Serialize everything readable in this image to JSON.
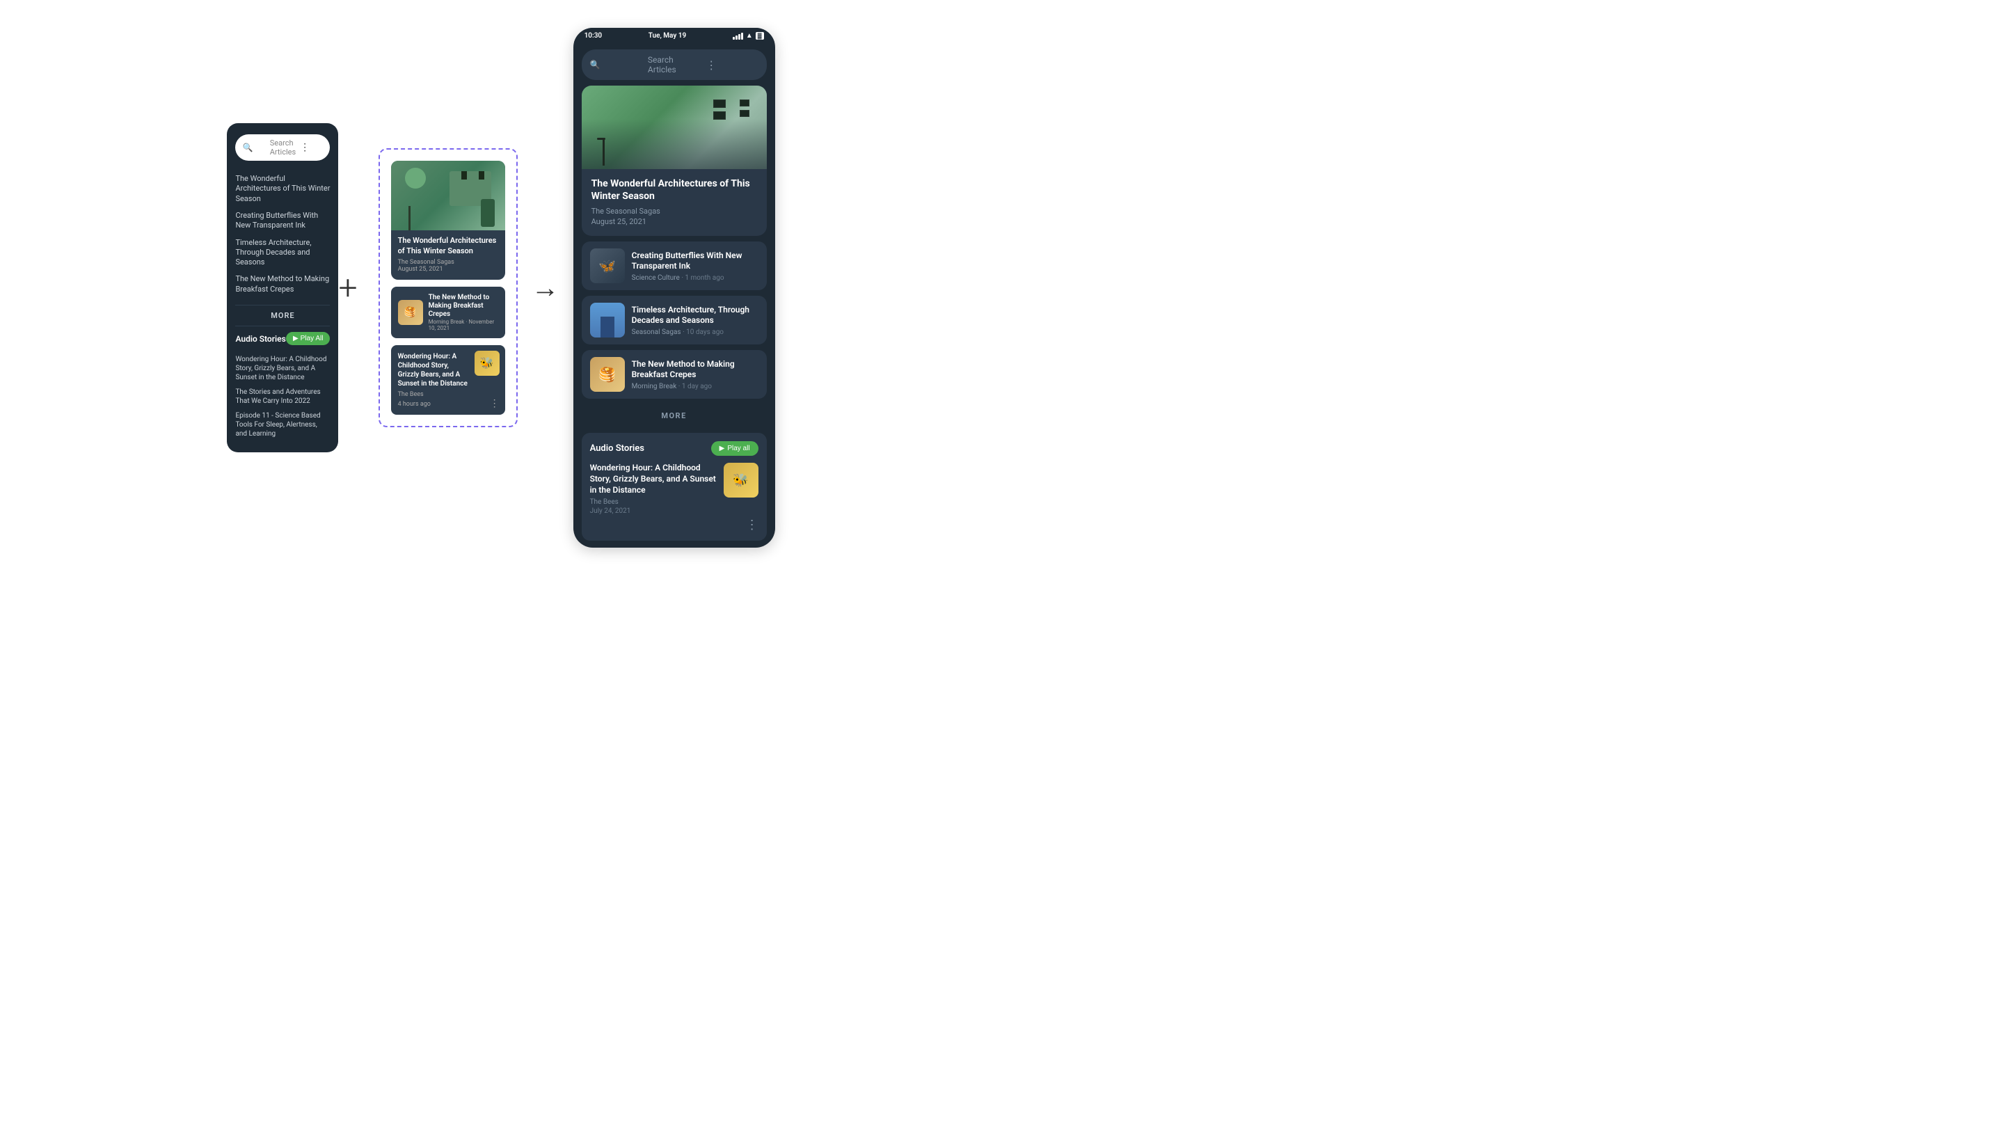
{
  "status_bar": {
    "time": "10:30",
    "date": "Tue, May 19"
  },
  "search": {
    "placeholder": "Search Articles"
  },
  "hero_article": {
    "title": "The Wonderful Architectures of This Winter Season",
    "source": "The Seasonal Sagas",
    "date": "August 25, 2021"
  },
  "articles": [
    {
      "title": "Creating Butterflies With New Transparent Ink",
      "source": "Science Culture",
      "time": "1 month ago",
      "thumb_type": "butterflies"
    },
    {
      "title": "Timeless Architecture, Through Decades and Seasons",
      "source": "Seasonal Sagas",
      "time": "10 days ago",
      "thumb_type": "architecture"
    },
    {
      "title": "The New Method to Making Breakfast Crepes",
      "source": "Morning Break",
      "time": "1 day ago",
      "thumb_type": "crepes"
    }
  ],
  "more_label": "MORE",
  "audio_section": {
    "title": "Audio Stories",
    "play_all_label": "Play all",
    "items": [
      {
        "title": "Wondering Hour: A Childhood Story, Grizzly Bears, and A Sunset in the Distance",
        "source": "The Bees",
        "date": "July 24, 2021"
      }
    ]
  },
  "left_phone": {
    "search_placeholder": "Search Articles",
    "articles": [
      "The Wonderful Architectures of This Winter Season",
      "Creating Butterflies With New Transparent Ink",
      "Timeless Architecture, Through Decades and Seasons",
      "The New Method to Making Breakfast Crepes"
    ],
    "more_label": "MORE",
    "audio_title": "Audio Stories",
    "play_all_label": "Play All",
    "audio_items": [
      "Wondering Hour: A Childhood Story, Grizzly Bears, and A Sunset in the Distance",
      "The Stories and Adventures That We Carry Into 2022",
      "Episode 11 - Science Based Tools For Sleep, Alertness, and Learning"
    ]
  },
  "wireframe": {
    "hero_title": "The Wonderful Architectures of This Winter Season",
    "hero_source": "The Seasonal Sagas",
    "hero_date": "August 25, 2021",
    "card2_title": "The New Method to Making Breakfast Crepes",
    "card2_source": "Morning Break",
    "card2_date": "November 10, 2021",
    "card3_title": "Wondering Hour: A Childhood Story, Grizzly Bears, and A Sunset in the Distance",
    "card3_source": "The Bees",
    "card3_time": "4 hours ago"
  }
}
